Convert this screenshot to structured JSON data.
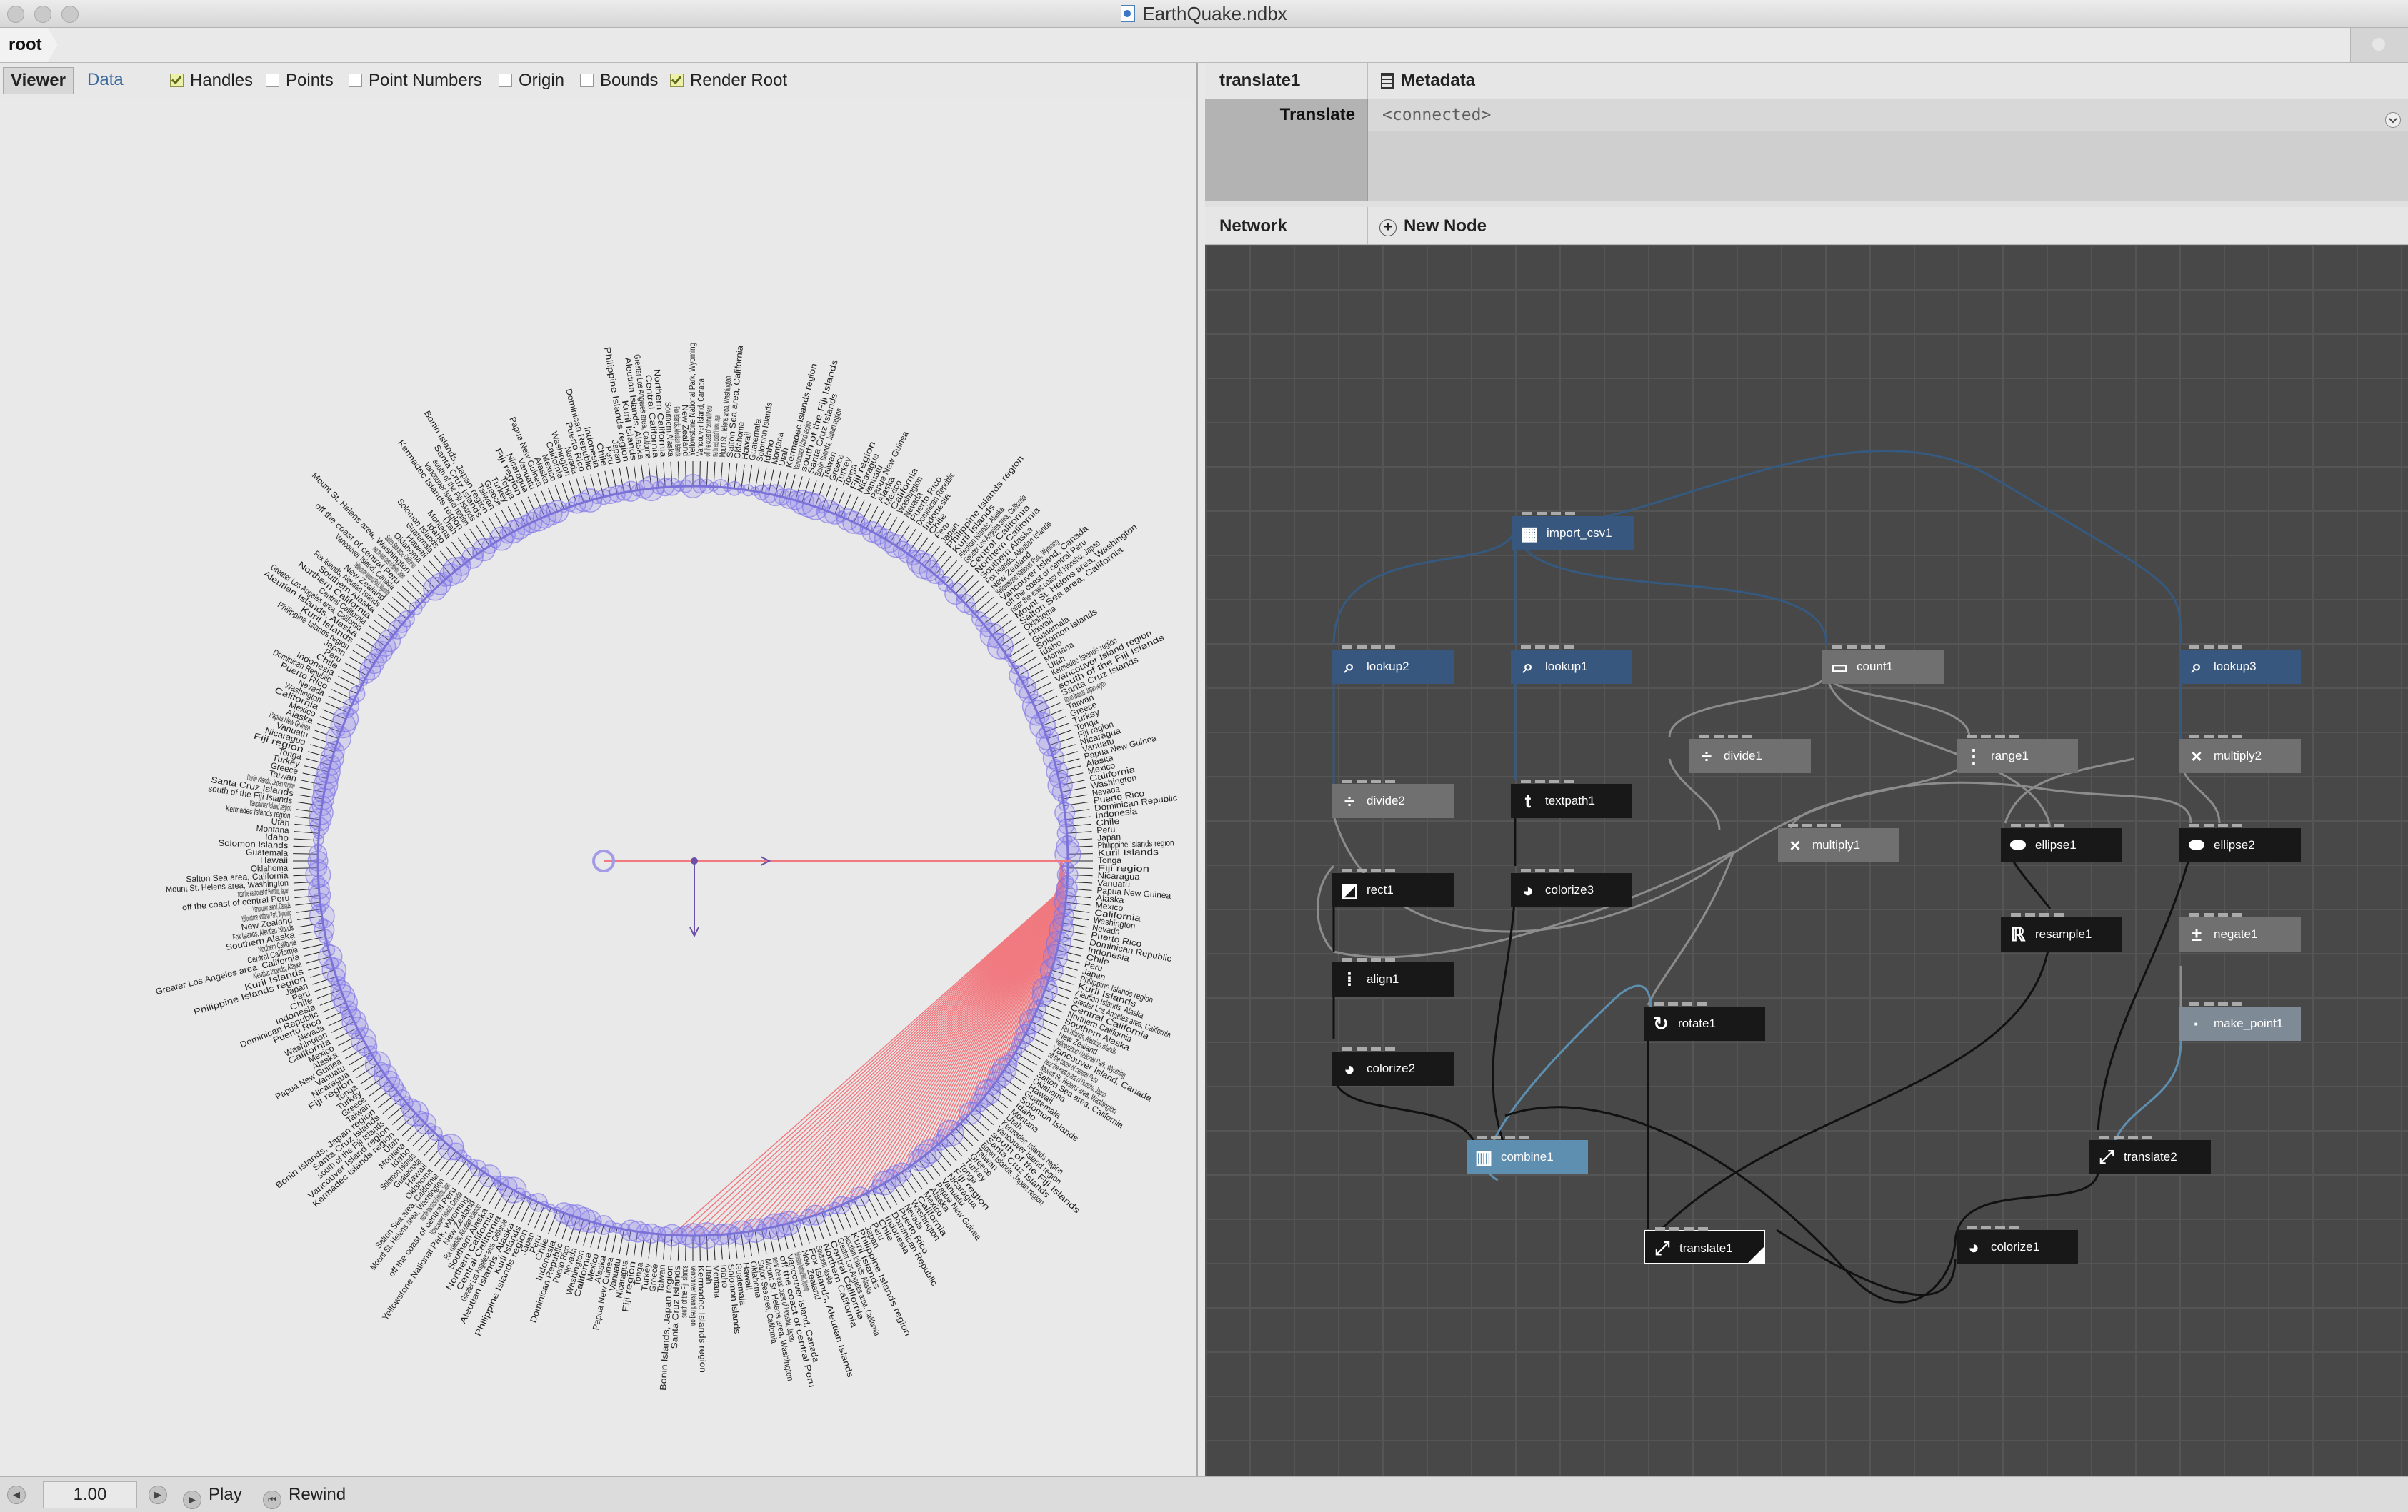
{
  "window": {
    "title": "EarthQuake.ndbx"
  },
  "breadcrumb": {
    "root": "root"
  },
  "viewer": {
    "tabs": [
      {
        "label": "Viewer"
      },
      {
        "label": "Data"
      }
    ],
    "options": [
      {
        "label": "Handles",
        "checked": true
      },
      {
        "label": "Points",
        "checked": false
      },
      {
        "label": "Point Numbers",
        "checked": false
      },
      {
        "label": "Origin",
        "checked": false
      },
      {
        "label": "Bounds",
        "checked": false
      },
      {
        "label": "Render Root",
        "checked": true
      }
    ],
    "place_labels": [
      "Tonga",
      "Fiji region",
      "Nicaragua",
      "Vanuatu",
      "Papua New Guinea",
      "Alaska",
      "Mexico",
      "California",
      "Washington",
      "Nevada",
      "Puerto Rico",
      "Dominican Republic",
      "Indonesia",
      "Chile",
      "Peru",
      "Japan",
      "Philippine Islands region",
      "Kuril Islands",
      "Aleutian Islands, Alaska",
      "Greater Los Angeles area, California",
      "Central California",
      "Northern California",
      "Southern Alaska",
      "Fox Islands, Aleutian Islands",
      "New Zealand",
      "Yellowstone National Park, Wyoming",
      "Vancouver Island, Canada",
      "off the coast of central Peru",
      "near the east coast of Honshu, Japan",
      "Mount St. Helens area, Washington",
      "Salton Sea area, California",
      "Oklahoma",
      "Hawaii",
      "Guatemala",
      "Solomon Islands",
      "Idaho",
      "Montana",
      "Utah",
      "Kermadec Islands region",
      "Vancouver Island region",
      "south of the Fiji Islands",
      "Santa Cruz Islands",
      "Bonin Islands, Japan region",
      "Taiwan",
      "Greece",
      "Turkey"
    ]
  },
  "parameters": {
    "node_name": "translate1",
    "metadata_label": "Metadata",
    "param_label": "Translate",
    "param_value": "<connected>"
  },
  "network": {
    "label": "Network",
    "new_node_label": "New Node",
    "nodes": [
      {
        "name": "import_csv1",
        "icon": "table-icon"
      },
      {
        "name": "lookup2",
        "icon": "magnifier-icon"
      },
      {
        "name": "lookup1",
        "icon": "magnifier-icon"
      },
      {
        "name": "count1",
        "icon": "counter-icon"
      },
      {
        "name": "lookup3",
        "icon": "magnifier-icon"
      },
      {
        "name": "divide1",
        "icon": "divide-icon"
      },
      {
        "name": "range1",
        "icon": "range-icon"
      },
      {
        "name": "multiply2",
        "icon": "multiply-icon"
      },
      {
        "name": "divide2",
        "icon": "divide-icon"
      },
      {
        "name": "textpath1",
        "icon": "text-t-icon"
      },
      {
        "name": "multiply1",
        "icon": "multiply-icon"
      },
      {
        "name": "ellipse1",
        "icon": "ellipse-icon"
      },
      {
        "name": "ellipse2",
        "icon": "ellipse-icon"
      },
      {
        "name": "rect1",
        "icon": "rect-icon"
      },
      {
        "name": "colorize3",
        "icon": "palette-icon"
      },
      {
        "name": "resample1",
        "icon": "resample-icon"
      },
      {
        "name": "negate1",
        "icon": "negate-icon"
      },
      {
        "name": "align1",
        "icon": "align-icon"
      },
      {
        "name": "rotate1",
        "icon": "rotate-icon"
      },
      {
        "name": "make_point1",
        "icon": "point-icon"
      },
      {
        "name": "colorize2",
        "icon": "palette-icon"
      },
      {
        "name": "combine1",
        "icon": "combine-icon"
      },
      {
        "name": "translate2",
        "icon": "translate-icon"
      },
      {
        "name": "translate1",
        "icon": "translate-icon"
      },
      {
        "name": "colorize1",
        "icon": "palette-icon"
      }
    ]
  },
  "playback": {
    "frame": "1.00",
    "play_label": "Play",
    "rewind_label": "Rewind"
  }
}
